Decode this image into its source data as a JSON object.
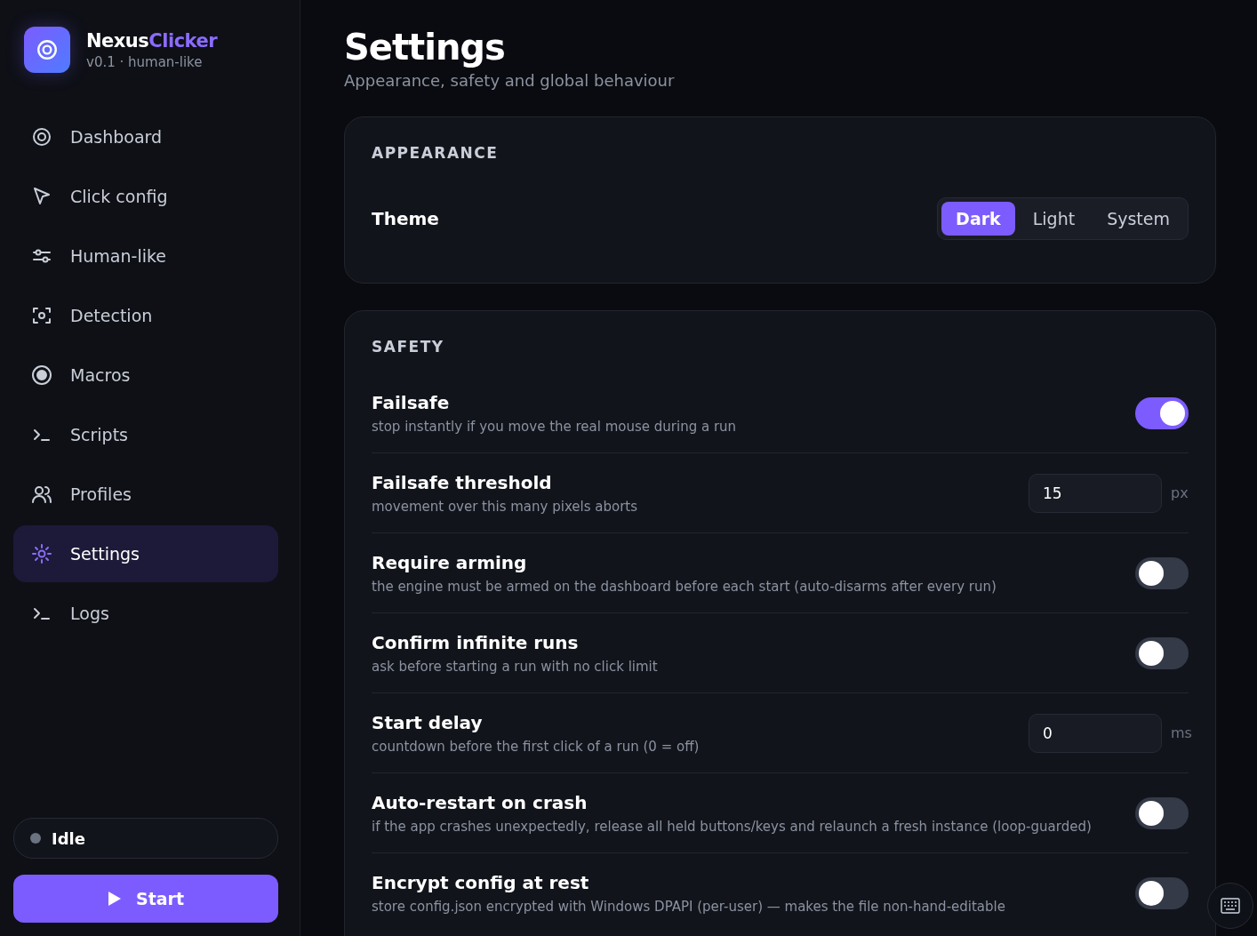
{
  "app": {
    "name_part1": "Nexus",
    "name_part2": "Clicker",
    "version": "v0.1 · human-like"
  },
  "nav": [
    {
      "label": "Dashboard",
      "selected": false
    },
    {
      "label": "Click config",
      "selected": false
    },
    {
      "label": "Human-like",
      "selected": false
    },
    {
      "label": "Detection",
      "selected": false
    },
    {
      "label": "Macros",
      "selected": false
    },
    {
      "label": "Scripts",
      "selected": false
    },
    {
      "label": "Profiles",
      "selected": false
    },
    {
      "label": "Settings",
      "selected": true
    },
    {
      "label": "Logs",
      "selected": false
    }
  ],
  "status": {
    "label": "Idle",
    "color": "#6b7280"
  },
  "start_button": "Start",
  "page": {
    "title": "Settings",
    "subtitle": "Appearance, safety and global behaviour"
  },
  "appearance": {
    "heading": "APPEARANCE",
    "theme_label": "Theme",
    "options": [
      {
        "label": "Dark",
        "selected": true
      },
      {
        "label": "Light",
        "selected": false
      },
      {
        "label": "System",
        "selected": false
      }
    ]
  },
  "safety": {
    "heading": "SAFETY",
    "rows": [
      {
        "kind": "toggle",
        "title": "Failsafe",
        "description": "stop instantly if you move the real mouse during a run",
        "on": true
      },
      {
        "kind": "number",
        "title": "Failsafe threshold",
        "description": "movement over this many pixels aborts",
        "value": "15",
        "unit": "px"
      },
      {
        "kind": "toggle",
        "title": "Require arming",
        "description": "the engine must be armed on the dashboard before each start (auto-disarms after every run)",
        "on": false
      },
      {
        "kind": "toggle",
        "title": "Confirm infinite runs",
        "description": "ask before starting a run with no click limit",
        "on": false
      },
      {
        "kind": "number",
        "title": "Start delay",
        "description": "countdown before the first click of a run (0 = off)",
        "value": "0",
        "unit": "ms"
      },
      {
        "kind": "toggle",
        "title": "Auto-restart on crash",
        "description": "if the app crashes unexpectedly, release all held buttons/keys and relaunch a fresh instance (loop-guarded)",
        "on": false
      },
      {
        "kind": "toggle",
        "title": "Encrypt config at rest",
        "description": "store config.json encrypted with Windows DPAPI (per-user) — makes the file non-hand-editable",
        "on": false
      }
    ]
  }
}
